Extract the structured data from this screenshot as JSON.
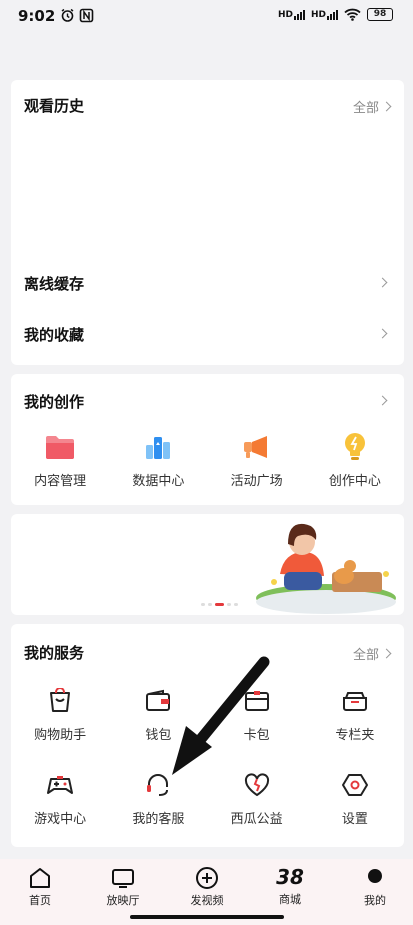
{
  "status_bar": {
    "time": "9:02",
    "battery": "98"
  },
  "watch_history": {
    "title": "观看历史",
    "more": "全部",
    "rows": [
      "离线缓存",
      "我的收藏"
    ]
  },
  "creation": {
    "title": "我的创作",
    "items": [
      {
        "label": "内容管理",
        "icon": "folder-icon"
      },
      {
        "label": "数据中心",
        "icon": "data-chart-icon"
      },
      {
        "label": "活动广场",
        "icon": "megaphone-icon"
      },
      {
        "label": "创作中心",
        "icon": "lightbulb-icon"
      }
    ]
  },
  "banner": {
    "slides": 5,
    "active": 2
  },
  "services": {
    "title": "我的服务",
    "more": "全部",
    "items": [
      {
        "label": "购物助手",
        "icon": "shopping-bag-icon"
      },
      {
        "label": "钱包",
        "icon": "wallet-icon"
      },
      {
        "label": "卡包",
        "icon": "card-icon"
      },
      {
        "label": "专栏夹",
        "icon": "folder-tray-icon"
      },
      {
        "label": "游戏中心",
        "icon": "gamepad-icon"
      },
      {
        "label": "我的客服",
        "icon": "headset-icon"
      },
      {
        "label": "西瓜公益",
        "icon": "heart-icon"
      },
      {
        "label": "设置",
        "icon": "settings-icon"
      }
    ]
  },
  "tabbar": {
    "items": [
      {
        "label": "首页",
        "icon": "home-icon"
      },
      {
        "label": "放映厅",
        "icon": "tv-icon"
      },
      {
        "label": "发视频",
        "icon": "plus-circle-icon"
      },
      {
        "label": "商城",
        "icon": "mall-38-icon",
        "badge": "38"
      },
      {
        "label": "我的",
        "icon": "profile-icon"
      }
    ]
  },
  "colors": {
    "accent": "#e4393c",
    "background": "#f2f2f4"
  }
}
